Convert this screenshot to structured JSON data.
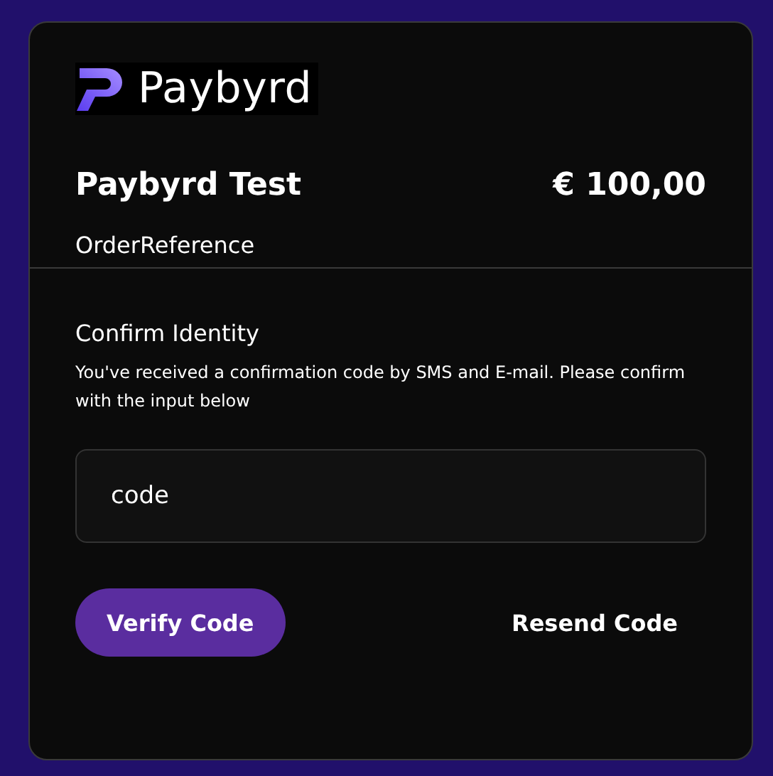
{
  "logo": {
    "text": "Paybyrd"
  },
  "merchant": {
    "name": "Paybyrd Test",
    "amount": "€ 100,00",
    "reference": "OrderReference"
  },
  "verification": {
    "title": "Confirm Identity",
    "message": "You've received a confirmation code by SMS and E-mail. Please confirm with the input below",
    "code_field": {
      "value": "code"
    }
  },
  "buttons": [
    {
      "kind": "primary",
      "label": "Verify Code"
    },
    {
      "kind": "link",
      "label": "Resend Code"
    }
  ]
}
